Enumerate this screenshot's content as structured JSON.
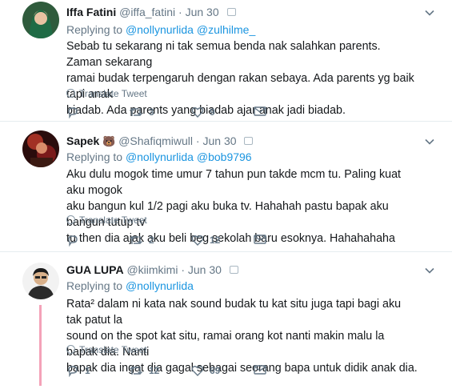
{
  "tweets": [
    {
      "name": "Iffa Fatini",
      "handle": "@iffa_fatini",
      "sep": "·",
      "date": "Jun 30",
      "replying_label": "Replying to",
      "mentions": [
        "@nollynurlida",
        "@zulhilme_"
      ],
      "text_lines": [
        "Sebab tu sekarang ni tak semua benda nak salahkan parents. Zaman sekarang",
        "ramai budak terpengaruh dengan rakan sebaya. Ada parents yg baik tapi anak",
        "biadab. Ada parents yang biadab ajar anak jadi biadab."
      ],
      "translate": "Translate Tweet",
      "replies": "",
      "retweets": "3",
      "likes": "9"
    },
    {
      "name": "Sapek",
      "emoji": "🐻",
      "handle": "@Shafiqmiwull",
      "sep": "·",
      "date": "Jun 30",
      "replying_label": "Replying to",
      "mentions": [
        "@nollynurlida",
        "@bob9796"
      ],
      "text_lines": [
        "Aku dulu mogok time umur 7 tahun pun takde mcm tu. Paling kuat aku mogok",
        "aku bangun kul 1/2 pagi aku buka tv. Hahahah pastu bapak aku bangun tutup tv",
        "tu then dia ajak aku beli beg sekolah baru esoknya. Hahahahaha"
      ],
      "translate": "Translate Tweet",
      "replies": "",
      "retweets": "2",
      "likes": "12"
    },
    {
      "name": "GUA LUPA",
      "handle": "@kiimkimi",
      "sep": "·",
      "date": "Jun 30",
      "replying_label": "Replying to",
      "mentions": [
        "@nollynurlida"
      ],
      "text_lines": [
        "Rata² dalam ni kata nak sound budak tu kat situ juga tapi bagi aku tak patut la",
        "sound on the spot kat situ, ramai orang kot nanti makin malu la bapak dia. Nanti",
        "bapak dia ingat dia gagal sebagai seorang bapa untuk didik anak dia."
      ],
      "translate": "Translate Tweet",
      "replies": "1",
      "retweets": "12",
      "likes": "69"
    }
  ],
  "colors": {
    "link": "#1b95e0",
    "muted": "#657786",
    "thread": "#f4a2b8"
  }
}
